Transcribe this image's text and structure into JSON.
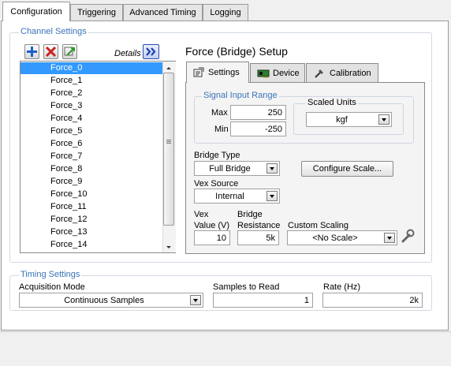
{
  "top_tabs": [
    "Configuration",
    "Triggering",
    "Advanced Timing",
    "Logging"
  ],
  "channel_settings": {
    "title": "Channel Settings",
    "details_label": "Details",
    "channels": [
      "Force_0",
      "Force_1",
      "Force_2",
      "Force_3",
      "Force_4",
      "Force_5",
      "Force_6",
      "Force_7",
      "Force_8",
      "Force_9",
      "Force_10",
      "Force_11",
      "Force_12",
      "Force_13",
      "Force_14"
    ],
    "selected_index": 0
  },
  "setup": {
    "title": "Force (Bridge) Setup",
    "tabs": [
      "Settings",
      "Device",
      "Calibration"
    ],
    "signal_input_range": {
      "title": "Signal Input Range",
      "max_label": "Max",
      "max_value": "250",
      "min_label": "Min",
      "min_value": "-250"
    },
    "scaled_units": {
      "title": "Scaled Units",
      "value": "kgf"
    },
    "bridge_type": {
      "label": "Bridge Type",
      "value": "Full Bridge"
    },
    "configure_scale_label": "Configure Scale...",
    "vex_source": {
      "label": "Vex Source",
      "value": "Internal"
    },
    "vex_value": {
      "label_line1": "Vex",
      "label_line2": "Value (V)",
      "value": "10"
    },
    "bridge_resistance": {
      "label_line1": "Bridge",
      "label_line2": "Resistance",
      "value": "5k"
    },
    "custom_scaling": {
      "label": "Custom Scaling",
      "value": "<No Scale>"
    }
  },
  "timing_settings": {
    "title": "Timing Settings",
    "acquisition_mode": {
      "label": "Acquisition Mode",
      "value": "Continuous Samples"
    },
    "samples_to_read": {
      "label": "Samples to Read",
      "value": "1"
    },
    "rate": {
      "label": "Rate (Hz)",
      "value": "2k"
    }
  },
  "colors": {
    "group_title": "#3b73b9",
    "selection": "#3399ff",
    "add_icon": "#1b5fcf",
    "remove_icon": "#cc2222",
    "details_button": "#1b3fb0"
  }
}
